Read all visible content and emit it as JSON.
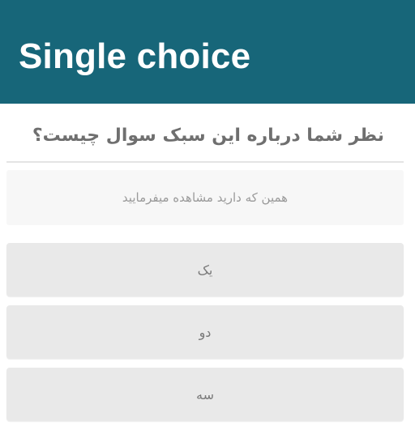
{
  "header": {
    "title": "Single choice",
    "background": "#176679"
  },
  "question": {
    "text": "نظر شما درباره این سبک سوال چیست؟",
    "hint": "همین که دارید مشاهده میفرمایید"
  },
  "options": [
    {
      "label": "یک"
    },
    {
      "label": "دو"
    },
    {
      "label": "سه"
    }
  ]
}
